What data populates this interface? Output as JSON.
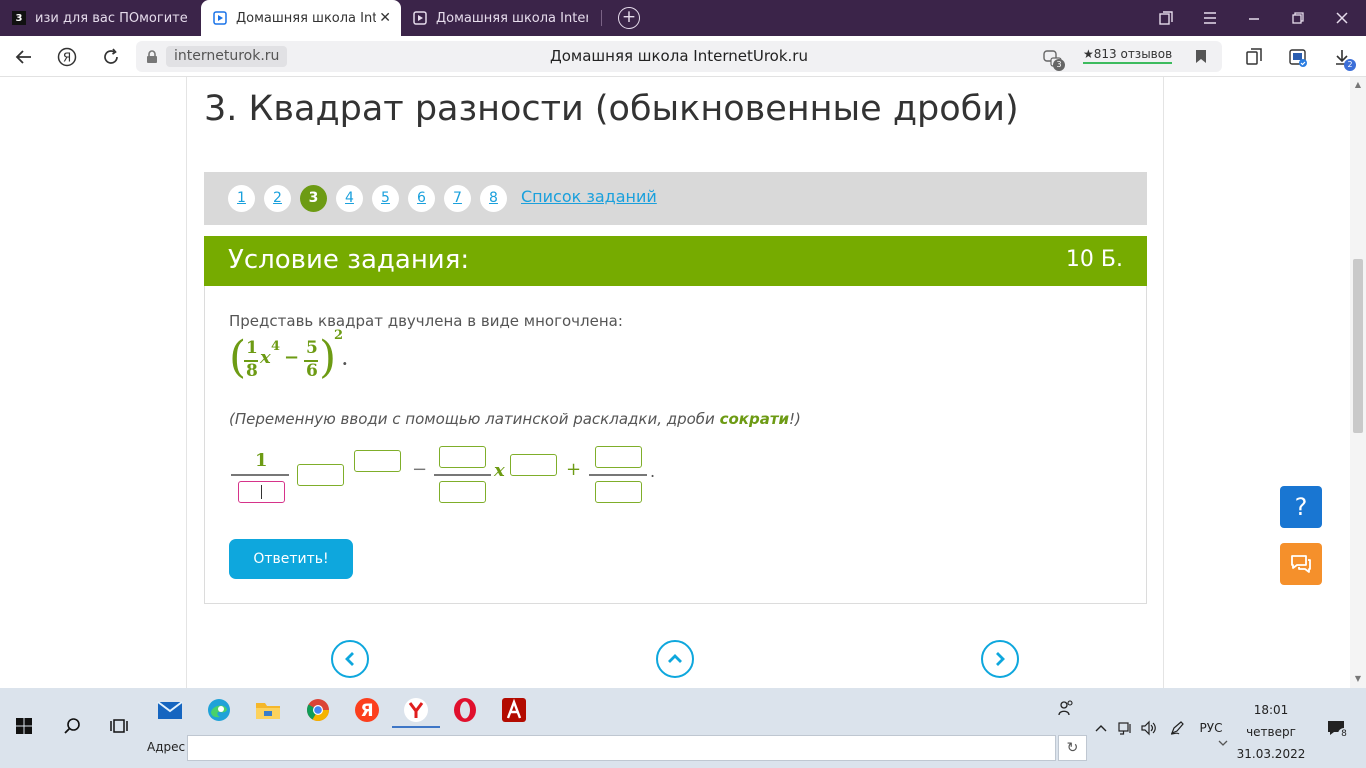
{
  "browser": {
    "tabs": [
      {
        "label": "изи для вас ПОмогите алгебра",
        "favicon": "3"
      },
      {
        "label": "Домашняя школа InternetUrok",
        "favicon": "play"
      },
      {
        "label": "Домашняя школа InternetUrok",
        "favicon": "play"
      }
    ],
    "new_tab": "+",
    "domain": "interneturok.ru",
    "page_title": "Домашняя школа InternetUrok.ru",
    "reviews": "★813 отзывов",
    "badge_tabs": "3",
    "badge_downloads": "2"
  },
  "page": {
    "lesson_title": "3. Квадрат разности (обыкновенные дроби)",
    "pager": {
      "pages": [
        "1",
        "2",
        "3",
        "4",
        "5",
        "6",
        "7",
        "8"
      ],
      "current": 3,
      "task_list": "Список заданий"
    },
    "task": {
      "header": "Условие задания:",
      "points": "10 Б.",
      "prompt": "Представь квадрат двучлена в виде многочлена:",
      "expr": {
        "num1": "1",
        "den1": "8",
        "var": "x",
        "exp": "4",
        "minus": "−",
        "num2": "5",
        "den2": "6",
        "power": "2",
        "end": "."
      },
      "hint_before": "(Переменную вводи с помощью латинской раскладки, дроби ",
      "hint_accent": "сократи",
      "hint_after": "!)",
      "answer": {
        "numerator": "1",
        "minus": "−",
        "var": "x",
        "plus": "+",
        "end": "."
      },
      "submit": "Ответить!"
    },
    "help": "?"
  },
  "taskbar": {
    "address_label": "Адрес",
    "lang": "РУС",
    "time": "18:01",
    "day": "четверг",
    "date": "31.03.2022",
    "notifications": "8"
  }
}
